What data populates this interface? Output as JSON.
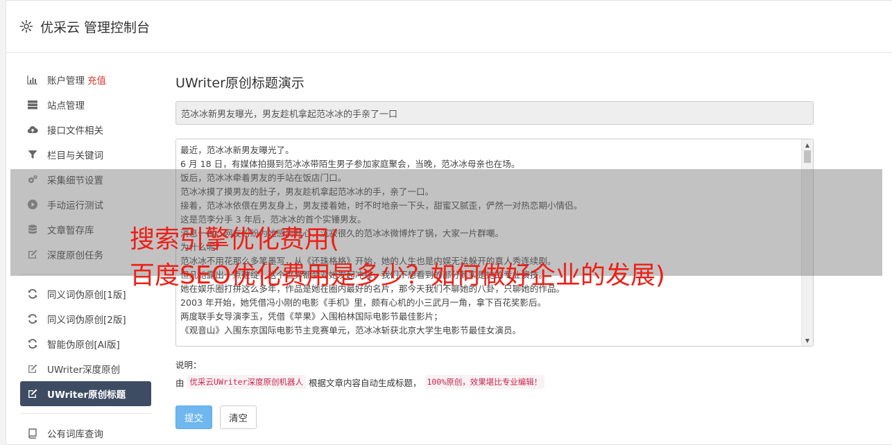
{
  "header": {
    "title": "优采云 管理控制台",
    "icon": "gear-icon"
  },
  "sidebar": {
    "recharge_label": "充值",
    "group1": [
      {
        "label": "账户管理",
        "icon": "bar-chart-icon"
      },
      {
        "label": "站点管理",
        "icon": "server-icon"
      },
      {
        "label": "接口文件相关",
        "icon": "cloud-upload-icon"
      },
      {
        "label": "栏目与关键词",
        "icon": "filter-icon"
      },
      {
        "label": "采集细节设置",
        "icon": "cogs-icon"
      },
      {
        "label": "手动运行测试",
        "icon": "play-circle-icon"
      },
      {
        "label": "文章暂存库",
        "icon": "database-icon"
      },
      {
        "label": "深度原创任务",
        "icon": "edit-icon"
      }
    ],
    "group2": [
      {
        "label": "同义词伪原创[1版]",
        "icon": "refresh-icon"
      },
      {
        "label": "同义词伪原创[2版]",
        "icon": "refresh-icon"
      },
      {
        "label": "智能伪原创[AI版]",
        "icon": "refresh-icon"
      },
      {
        "label": "UWriter深度原创",
        "icon": "edit-icon"
      },
      {
        "label": "UWriter原创标题",
        "icon": "edit-icon",
        "active": true
      }
    ],
    "group3": [
      {
        "label": "公有词库查询",
        "icon": "book-icon"
      }
    ]
  },
  "main": {
    "title": "UWriter原创标题演示",
    "generated_title": "范冰冰新男友曝光，男友趁机拿起范冰冰的手亲了一口",
    "article_lines": [
      "最近，范冰冰新男友曝光了。",
      "6 月 18 日，有媒体拍摄到范冰冰带陌生男子参加家庭聚会，当晚，范冰冰母亲也在场。",
      "饭后，范冰冰牵着男友的手站在饭店门口。",
      "范冰冰摸了摸男友的肚子，男友趁机拿起范冰冰的手，亲了一口。",
      "接着，范冰冰依偎在男友身上，男友搂着她，时不时地亲一下头，甜蜜又腻歪，俨然一对热恋期小情侣。",
      "这是范李分手 3 年后，范冰冰的首个实锤男友。",
      "消息一出，网友纷纷为她感到开心，沉寂很久的范冰冰微博炸了锅，大家一片群嘲。",
      "为什么呢？",
      "范冰冰不用花那么多笔墨写，从《还珠格格》开始，她的人生也是内娱无法躲开的真人秀连续剧。",
      "但凡她露出一点破绽，这个世界都会对她发起冲锋，我们不想看到的部分其实是她的专业演技。",
      "她在娱乐圈打拼这么多年，作品是她在圈内最好的名片，那今天我们不聊她的八卦，只聊她的作品。",
      "2003 年开始，她凭借冯小刚的电影《手机》里，颇有心机的小三武月一角，拿下百花奖影后。",
      "两度联手女导演李玉，凭借《苹果》入围柏林国际电影节最佳影片；",
      "《观音山》入围东京国际电影节主竞赛单元，范冰冰斩获北京大学生电影节最佳女演员。"
    ],
    "note_label": "说明：",
    "note_by": "由",
    "note_robot": "优采云UWriter深度原创机器人",
    "note_mid": "根据文章内容自动生成标题，",
    "note_badge": "100%原创，效果堪比专业编辑！",
    "submit_label": "提交",
    "clear_label": "清空"
  },
  "overlay": {
    "line1": "搜索引擎优化费用(",
    "line2": "百度SEO优化费用是多少？如何做好企业的发展)"
  }
}
